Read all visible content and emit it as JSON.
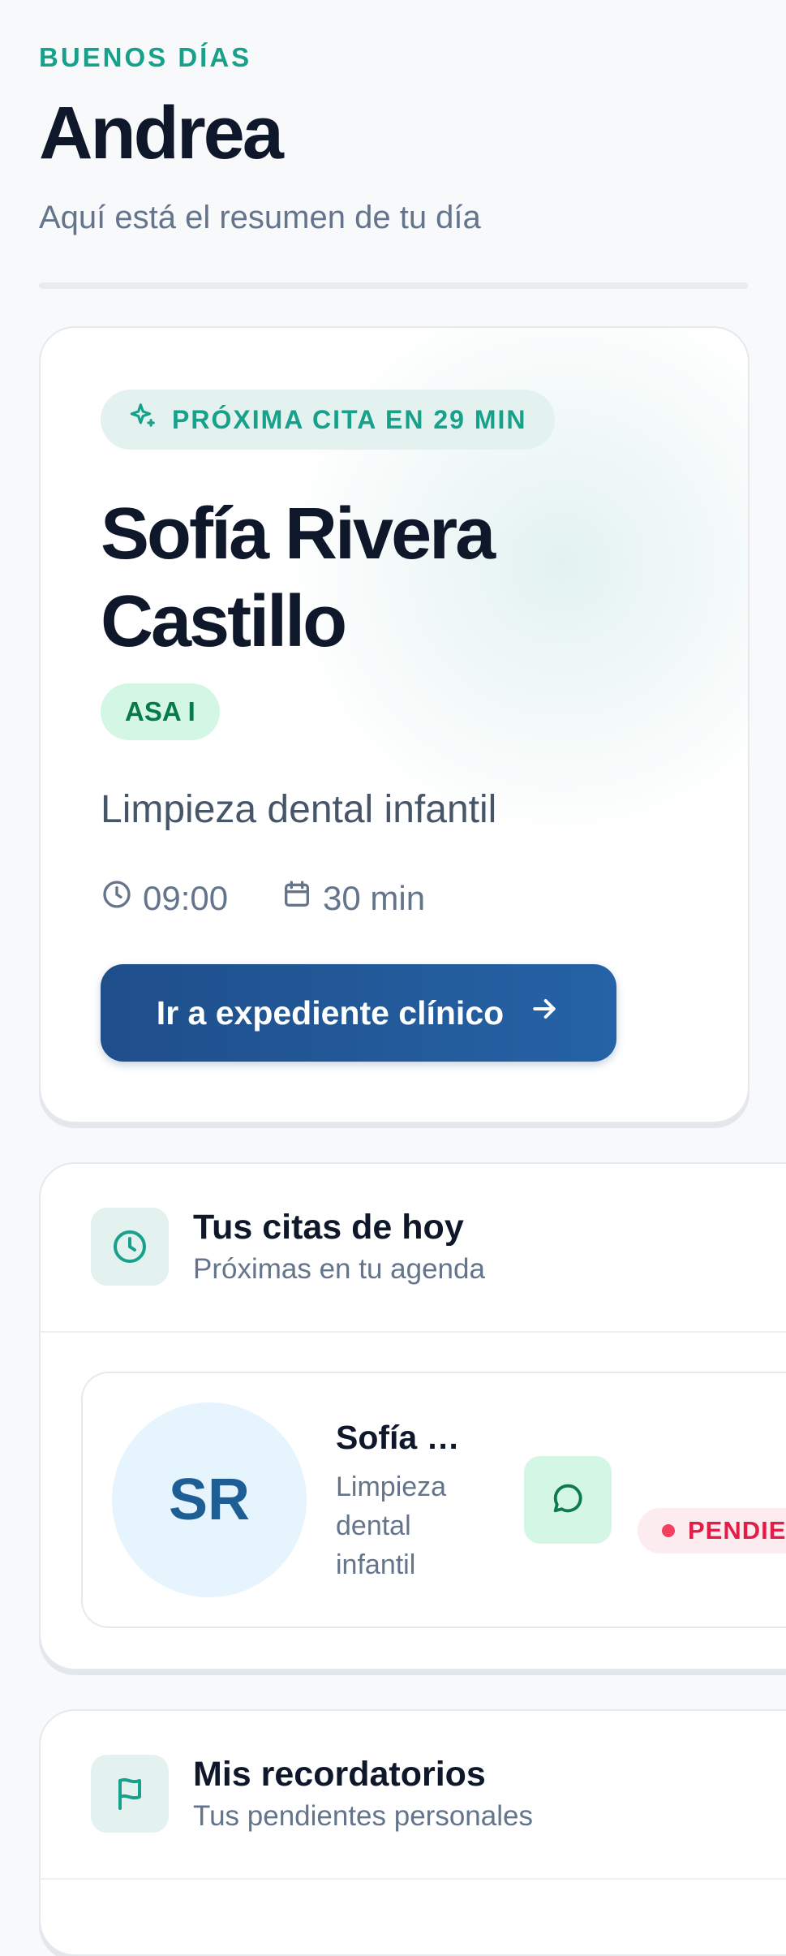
{
  "greeting": {
    "eyebrow": "BUENOS DÍAS",
    "name": "Andrea",
    "subtitle": "Aquí está el resumen de tu día"
  },
  "next_appointment": {
    "badge": "PRÓXIMA CITA EN 29 MIN",
    "patient_name": "Sofía Rivera Castillo",
    "asa": "ASA I",
    "procedure": "Limpieza dental infantil",
    "time": "09:00",
    "duration": "30 min",
    "cta_label": "Ir a expediente clínico"
  },
  "today": {
    "title": "Tus citas de hoy",
    "subtitle": "Próximas en tu agenda",
    "appointments": [
      {
        "initials": "SR",
        "name": "Sofía Rivera Castillo",
        "procedure": "Limpieza dental infantil",
        "status": "PENDIENTE"
      }
    ]
  },
  "reminders": {
    "title": "Mis recordatorios",
    "subtitle": "Tus pendientes personales"
  },
  "colors": {
    "accent": "#17a08a",
    "primary": "#1f4e8b",
    "pending": "#e11d48"
  }
}
